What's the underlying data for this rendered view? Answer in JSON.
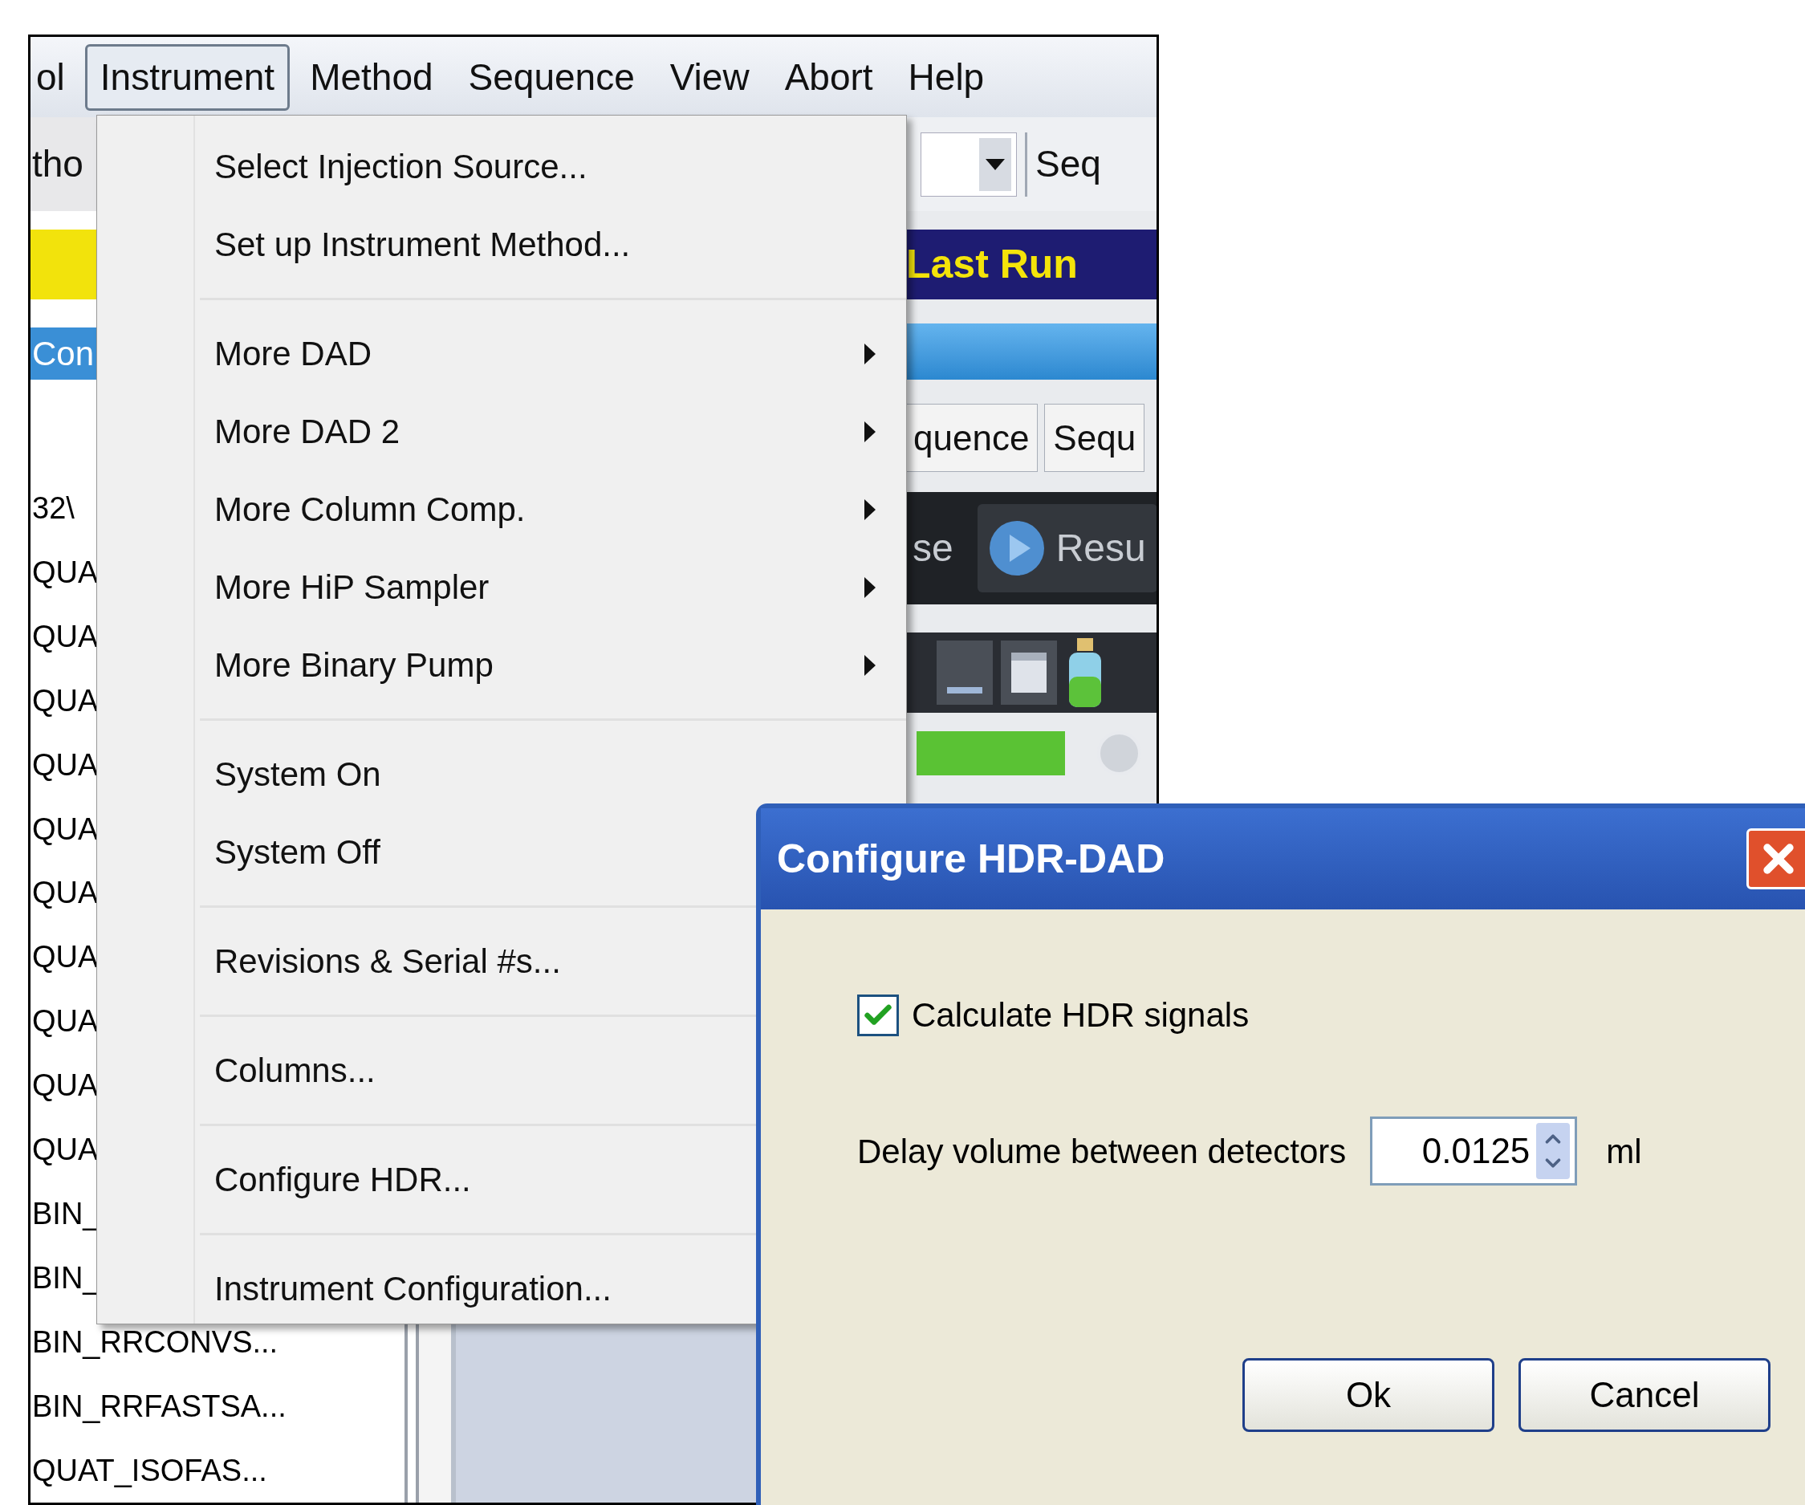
{
  "menu_bar": [
    {
      "label": "ol",
      "selected": false
    },
    {
      "label": "Instrument",
      "selected": true
    },
    {
      "label": "Method",
      "selected": false
    },
    {
      "label": "Sequence",
      "selected": false
    },
    {
      "label": "View",
      "selected": false
    },
    {
      "label": "Abort",
      "selected": false
    },
    {
      "label": "Help",
      "selected": false
    }
  ],
  "left_panel": {
    "toolbar_text": "tho",
    "tab": "Con",
    "list": [
      "32\\",
      "QUA",
      "QUA",
      "QUA",
      "QUA",
      "QUA",
      "QUA",
      "QUA",
      "QUA",
      "QUA",
      "QUA",
      "BIN_",
      "BIN_",
      "BIN_RRCONVS...",
      "BIN_RRFASTSA...",
      "QUAT_ISOFAS..."
    ]
  },
  "right_panel": {
    "combo_label": "Seq",
    "banner": "Last Run",
    "tabs": [
      "quence",
      "Sequ"
    ],
    "toolbar_buttons": [
      {
        "label": "se",
        "kind": "text"
      },
      {
        "label": "Resu",
        "kind": "play"
      }
    ]
  },
  "instrument_menu": {
    "groups": [
      [
        {
          "label": "Select Injection Source...",
          "submenu": false
        },
        {
          "label": "Set up Instrument Method...",
          "submenu": false
        }
      ],
      [
        {
          "label": "More DAD",
          "submenu": true
        },
        {
          "label": "More DAD 2",
          "submenu": true
        },
        {
          "label": "More Column Comp.",
          "submenu": true
        },
        {
          "label": "More HiP Sampler",
          "submenu": true
        },
        {
          "label": "More Binary Pump",
          "submenu": true
        }
      ],
      [
        {
          "label": "System On",
          "submenu": false
        },
        {
          "label": "System Off",
          "submenu": false
        }
      ],
      [
        {
          "label": "Revisions & Serial #s...",
          "submenu": false
        }
      ],
      [
        {
          "label": "Columns...",
          "submenu": false
        }
      ],
      [
        {
          "label": "Configure HDR...",
          "submenu": false
        }
      ],
      [
        {
          "label": "Instrument Configuration...",
          "submenu": false
        }
      ]
    ]
  },
  "dialog": {
    "title": "Configure HDR-DAD",
    "checkbox": {
      "label": "Calculate HDR signals",
      "checked": true
    },
    "delay": {
      "label": "Delay volume between detectors",
      "value": "0.0125",
      "unit": "ml"
    },
    "buttons": [
      "Ok",
      "Cancel"
    ]
  }
}
